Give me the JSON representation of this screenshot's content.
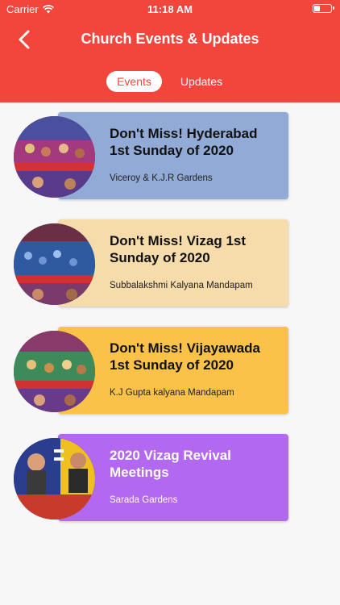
{
  "status_bar": {
    "carrier": "Carrier",
    "time": "11:18 AM"
  },
  "header": {
    "title": "Church Events & Updates",
    "back_icon": "chevron-left-icon",
    "background_color": "#f2453b"
  },
  "tabs": [
    {
      "label": "Events",
      "active": true
    },
    {
      "label": "Updates",
      "active": false
    }
  ],
  "events": [
    {
      "title": "Don't Miss! Hyderabad 1st Sunday of 2020",
      "venue": "Viceroy & K.J.R Gardens",
      "color": "#91aad6"
    },
    {
      "title": "Don't Miss! Vizag 1st Sunday of 2020",
      "venue": "Subbalakshmi Kalyana Mandapam",
      "color": "#f6dcaa"
    },
    {
      "title": "Don't Miss! Vijayawada 1st Sunday of 2020",
      "venue": "K.J Gupta kalyana Mandapam",
      "color": "#fbc24a"
    },
    {
      "title": "2020 Vizag Revival Meetings",
      "venue": "Sarada Gardens",
      "color": "#b368f1"
    }
  ]
}
